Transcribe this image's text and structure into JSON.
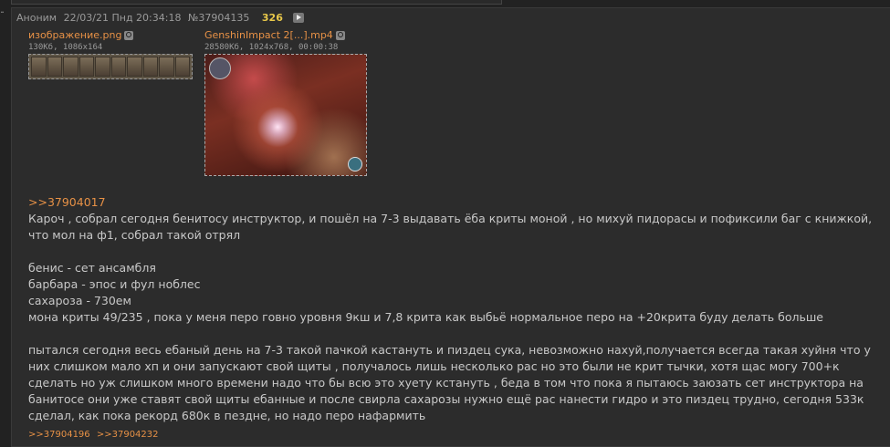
{
  "post": {
    "author": "Аноним",
    "date": "22/03/21 Пнд 20:34:18",
    "number": "№37904135",
    "reply_count": "326"
  },
  "files": [
    {
      "name": "изображение.png",
      "meta": "130Кб, 1086x164"
    },
    {
      "name": "GenshinImpact 2[...].mp4",
      "meta": "28580Кб, 1024x768, 00:00:38"
    }
  ],
  "body": {
    "quote": ">>37904017",
    "lines": [
      "Кароч , собрал сегодня бенитосу инструктор, и пошёл на 7-3 выдавать ёба криты моной , но михуй пидорасы и пофиксили баг с книжкой, что мол на ф1, собрал такой отрял",
      "",
      "бенис - сет ансамбля",
      "барбара - эпос и фул ноблес",
      "сахароза - 730ем",
      "мона криты 49/235 , пока у меня перо говно уровня 9кш и 7,8 крита как выбьё нормальное перо на +20крита буду делать больше",
      "",
      "пытался сегодня весь ебаный день на 7-3 такой пачкой кастануть и пиздец сука, невозможно нахуй,получается всегда такая хуйня что у них слишком мало хп и они запускают свой щиты , получалось лишь несколько рас но это были не крит тычки, хотя щас могу 700+к сделать но уж слишком много времени надо что бы всю это хуету кстануть , беда в том что пока я пытаюсь заюзать сет инструктора на банитосе они уже ставят свой щиты ебанные и после свирла сахарозы нужно ещё рас нанести гидро и это пиздец трудно, сегодня 533к сделал, как пока рекорд 680к в пездне, но надо перо нафармить"
    ]
  },
  "replies": [
    ">>37904196",
    ">>37904232"
  ]
}
